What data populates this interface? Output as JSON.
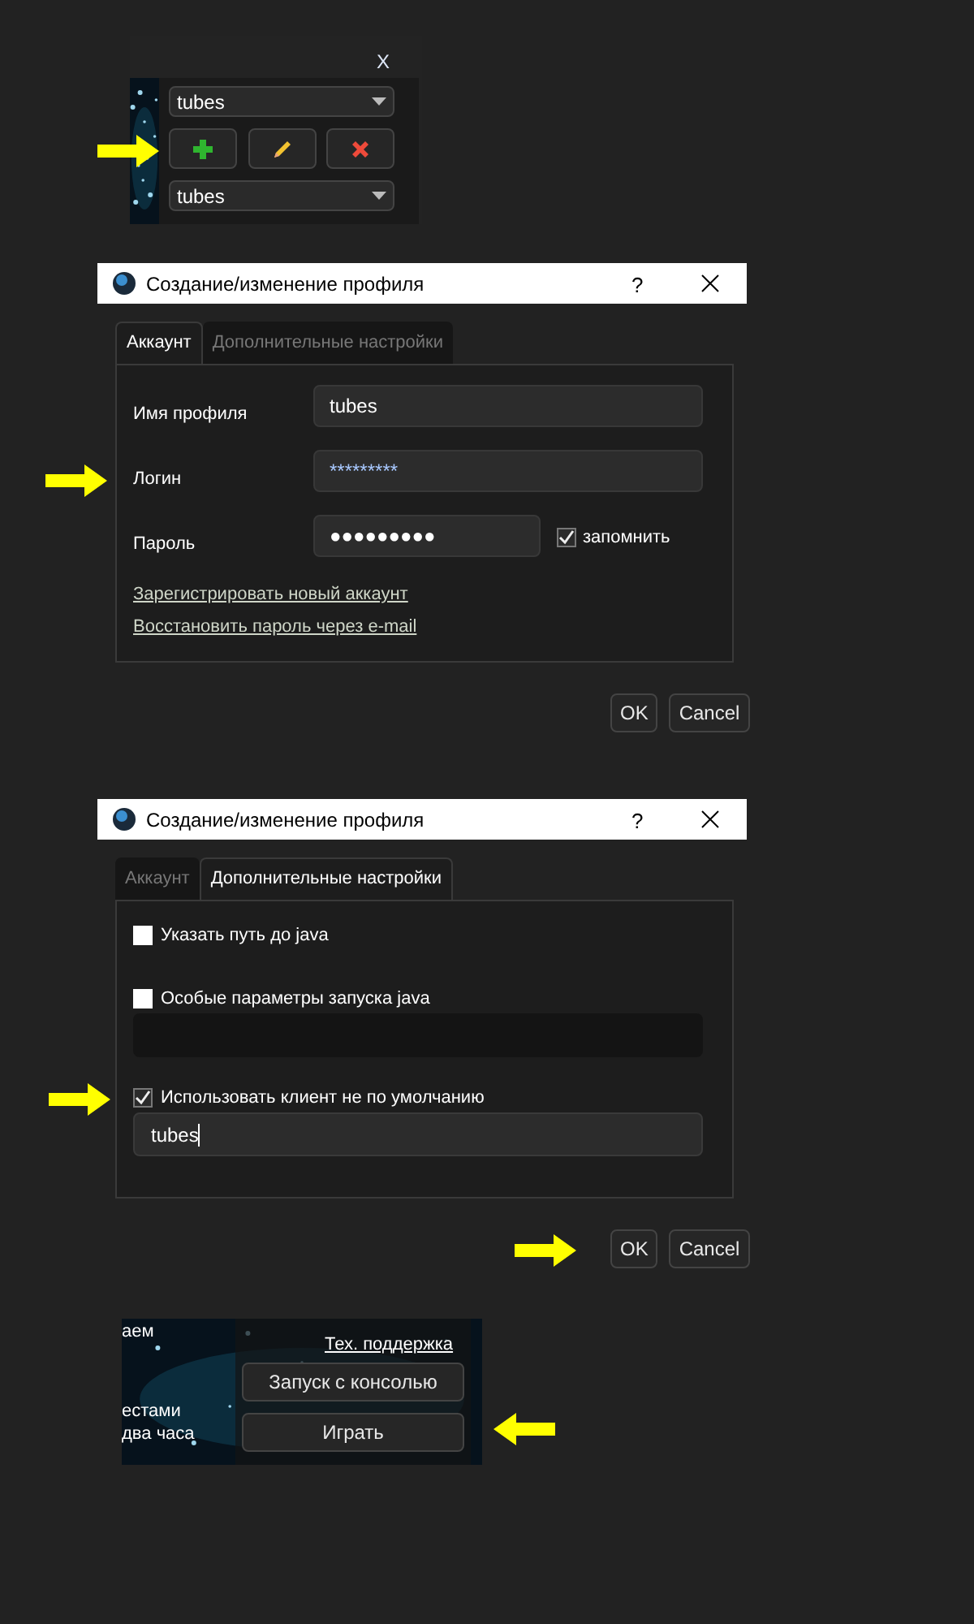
{
  "profile_selector": {
    "close": "X",
    "combo_top": "tubes",
    "combo_bottom": "tubes"
  },
  "dialogs": [
    {
      "title": "Создание/изменение профиля",
      "help": "?",
      "kind": "account",
      "tabs": [
        {
          "label": "Аккаунт",
          "selected": true
        },
        {
          "label": "Дополнительные настройки",
          "selected": false
        }
      ],
      "fields": [
        {
          "label": "Имя профиля",
          "value": "tubes"
        },
        {
          "label": "Логин",
          "value": "*********"
        },
        {
          "label": "Пароль",
          "value": "●●●●●●●●●",
          "remember": {
            "label": "запомнить",
            "checked": true
          }
        }
      ],
      "links": [
        "Зарегистрировать новый аккаунт",
        "Восстановить пароль через e-mail"
      ],
      "buttons": [
        "OK",
        "Cancel"
      ]
    },
    {
      "title": "Создание/изменение профиля",
      "help": "?",
      "kind": "advanced",
      "tabs": [
        {
          "label": "Аккаунт",
          "selected": false
        },
        {
          "label": "Дополнительные настройки",
          "selected": true
        }
      ],
      "options": [
        {
          "label": "Указать путь до java",
          "checked": false,
          "kind": "plain"
        },
        {
          "label": "Особые параметры запуска java",
          "checked": false,
          "kind": "field"
        },
        {
          "label": "Использовать клиент не по умолчанию",
          "checked": true,
          "kind": "field",
          "value": "tubes",
          "focused": true
        }
      ],
      "buttons": [
        "OK",
        "Cancel"
      ]
    }
  ],
  "launcher": {
    "news_lines": [
      "аем",
      "естами",
      "два часа"
    ],
    "support_link": "Тех. поддержка",
    "buttons": [
      "Запуск с консолью",
      "Играть"
    ]
  }
}
